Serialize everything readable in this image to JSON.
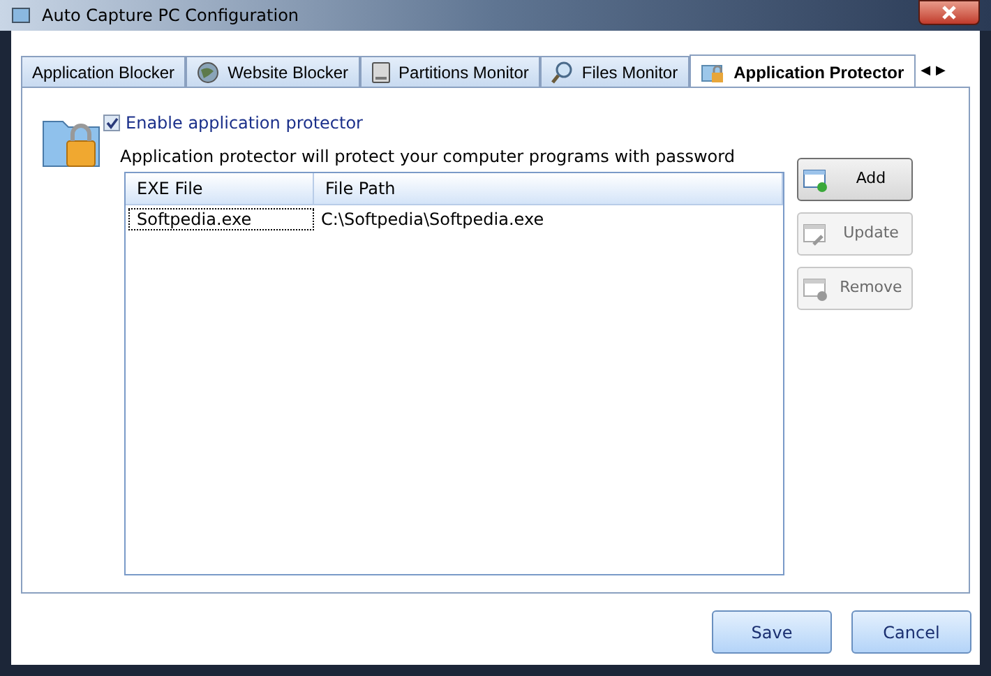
{
  "window": {
    "title": "Auto Capture PC Configuration"
  },
  "tabs": [
    {
      "label": "Application Blocker",
      "selected": false
    },
    {
      "label": "Website Blocker",
      "selected": false
    },
    {
      "label": "Partitions Monitor",
      "selected": false
    },
    {
      "label": "Files Monitor",
      "selected": false
    },
    {
      "label": "Application Protector",
      "selected": true
    }
  ],
  "tab_scroll": [
    "◀",
    "▶"
  ],
  "enable": {
    "label": "Enable application protector",
    "checked": true
  },
  "description": "Application protector will protect your computer programs with password",
  "table": {
    "columns": [
      "EXE File",
      "File Path"
    ],
    "rows": [
      {
        "cells": [
          "Softpedia.exe",
          "C:\\Softpedia\\Softpedia.exe"
        ],
        "selected": true
      }
    ]
  },
  "side_buttons": [
    {
      "label": "Add",
      "disabled": false,
      "kind": "add"
    },
    {
      "label": "Update",
      "disabled": true,
      "kind": "update"
    },
    {
      "label": "Remove",
      "disabled": true,
      "kind": "remove"
    }
  ],
  "footer_buttons": [
    "Save",
    "Cancel"
  ]
}
